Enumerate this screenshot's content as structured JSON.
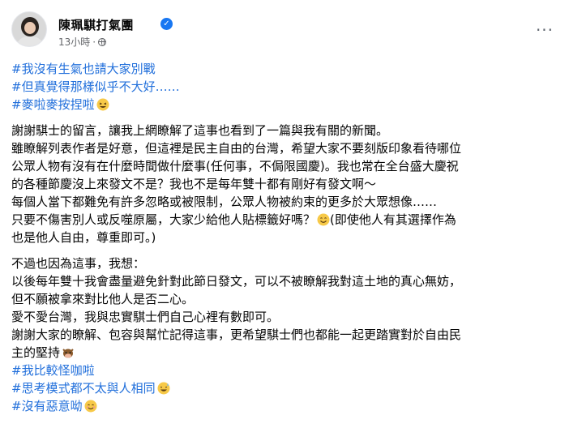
{
  "header": {
    "page_name": "陳珮騏打氣團",
    "time_ago": "13小時",
    "dot": "·",
    "verified_icon": "check-badge-icon",
    "privacy_icon": "globe-icon",
    "more_icon": "more-options-icon",
    "more_label": "···"
  },
  "colors": {
    "hashtag": "#216fdb",
    "verified": "#1877f2",
    "meta": "#65676b"
  },
  "post": {
    "p1": {
      "l1": "#我沒有生氣也請大家別戰",
      "l2": "#但真覺得那樣似乎不大好……",
      "l3": "#麥啦麥按捏啦"
    },
    "p2": {
      "l1": "謝謝騏士的留言，讓我上網瞭解了這事也看到了一篇與我有關的新聞。",
      "l2": "雖瞭解列表作者是好意，但這裡是民主自由的台灣，希望大家不要刻版印象看待哪位",
      "l3": "公眾人物有沒有在什麼時間做什麼事(任何事，不侷限國慶)。我也常在全台盛大慶祝",
      "l4": "的各種節慶沒上來發文不是？我也不是每年雙十都有剛好有發文啊～",
      "l5": "每個人當下都難免有許多忽略或被限制，公眾人物被約束的更多於大眾想像……",
      "l6": "只要不傷害別人或反噬原屬，大家少給他人貼標籤好嗎？",
      "l6b": "(即使他人有其選擇作為",
      "l7": "也是他人自由，尊重即可。)"
    },
    "p3": {
      "l1": "不過也因為這事，我想：",
      "l2": "以後每年雙十我會盡量避免針對此節日發文，可以不被瞭解我對這土地的真心無妨，",
      "l3": "但不願被拿來對比他人是否二心。",
      "l4": "愛不愛台灣，我與忠實騏士們自己心裡有數即可。",
      "l5": "謝謝大家的瞭解、包容與幫忙記得這事，更希望騏士們也都能一起更踏實對於自由民",
      "l6": "主的堅持",
      "l7": "#我比較怪咖啦",
      "l8": "#思考模式都不太與人相同",
      "l9": "#沒有惡意呦"
    },
    "emojis": {
      "grin": "grinning-squinting-face-emoji",
      "smile": "smiling-face-emoji",
      "cow": "cow-face-emoji",
      "sweat": "grinning-face-with-sweat-emoji",
      "blush": "smiling-face-with-smiling-eyes-emoji"
    }
  }
}
